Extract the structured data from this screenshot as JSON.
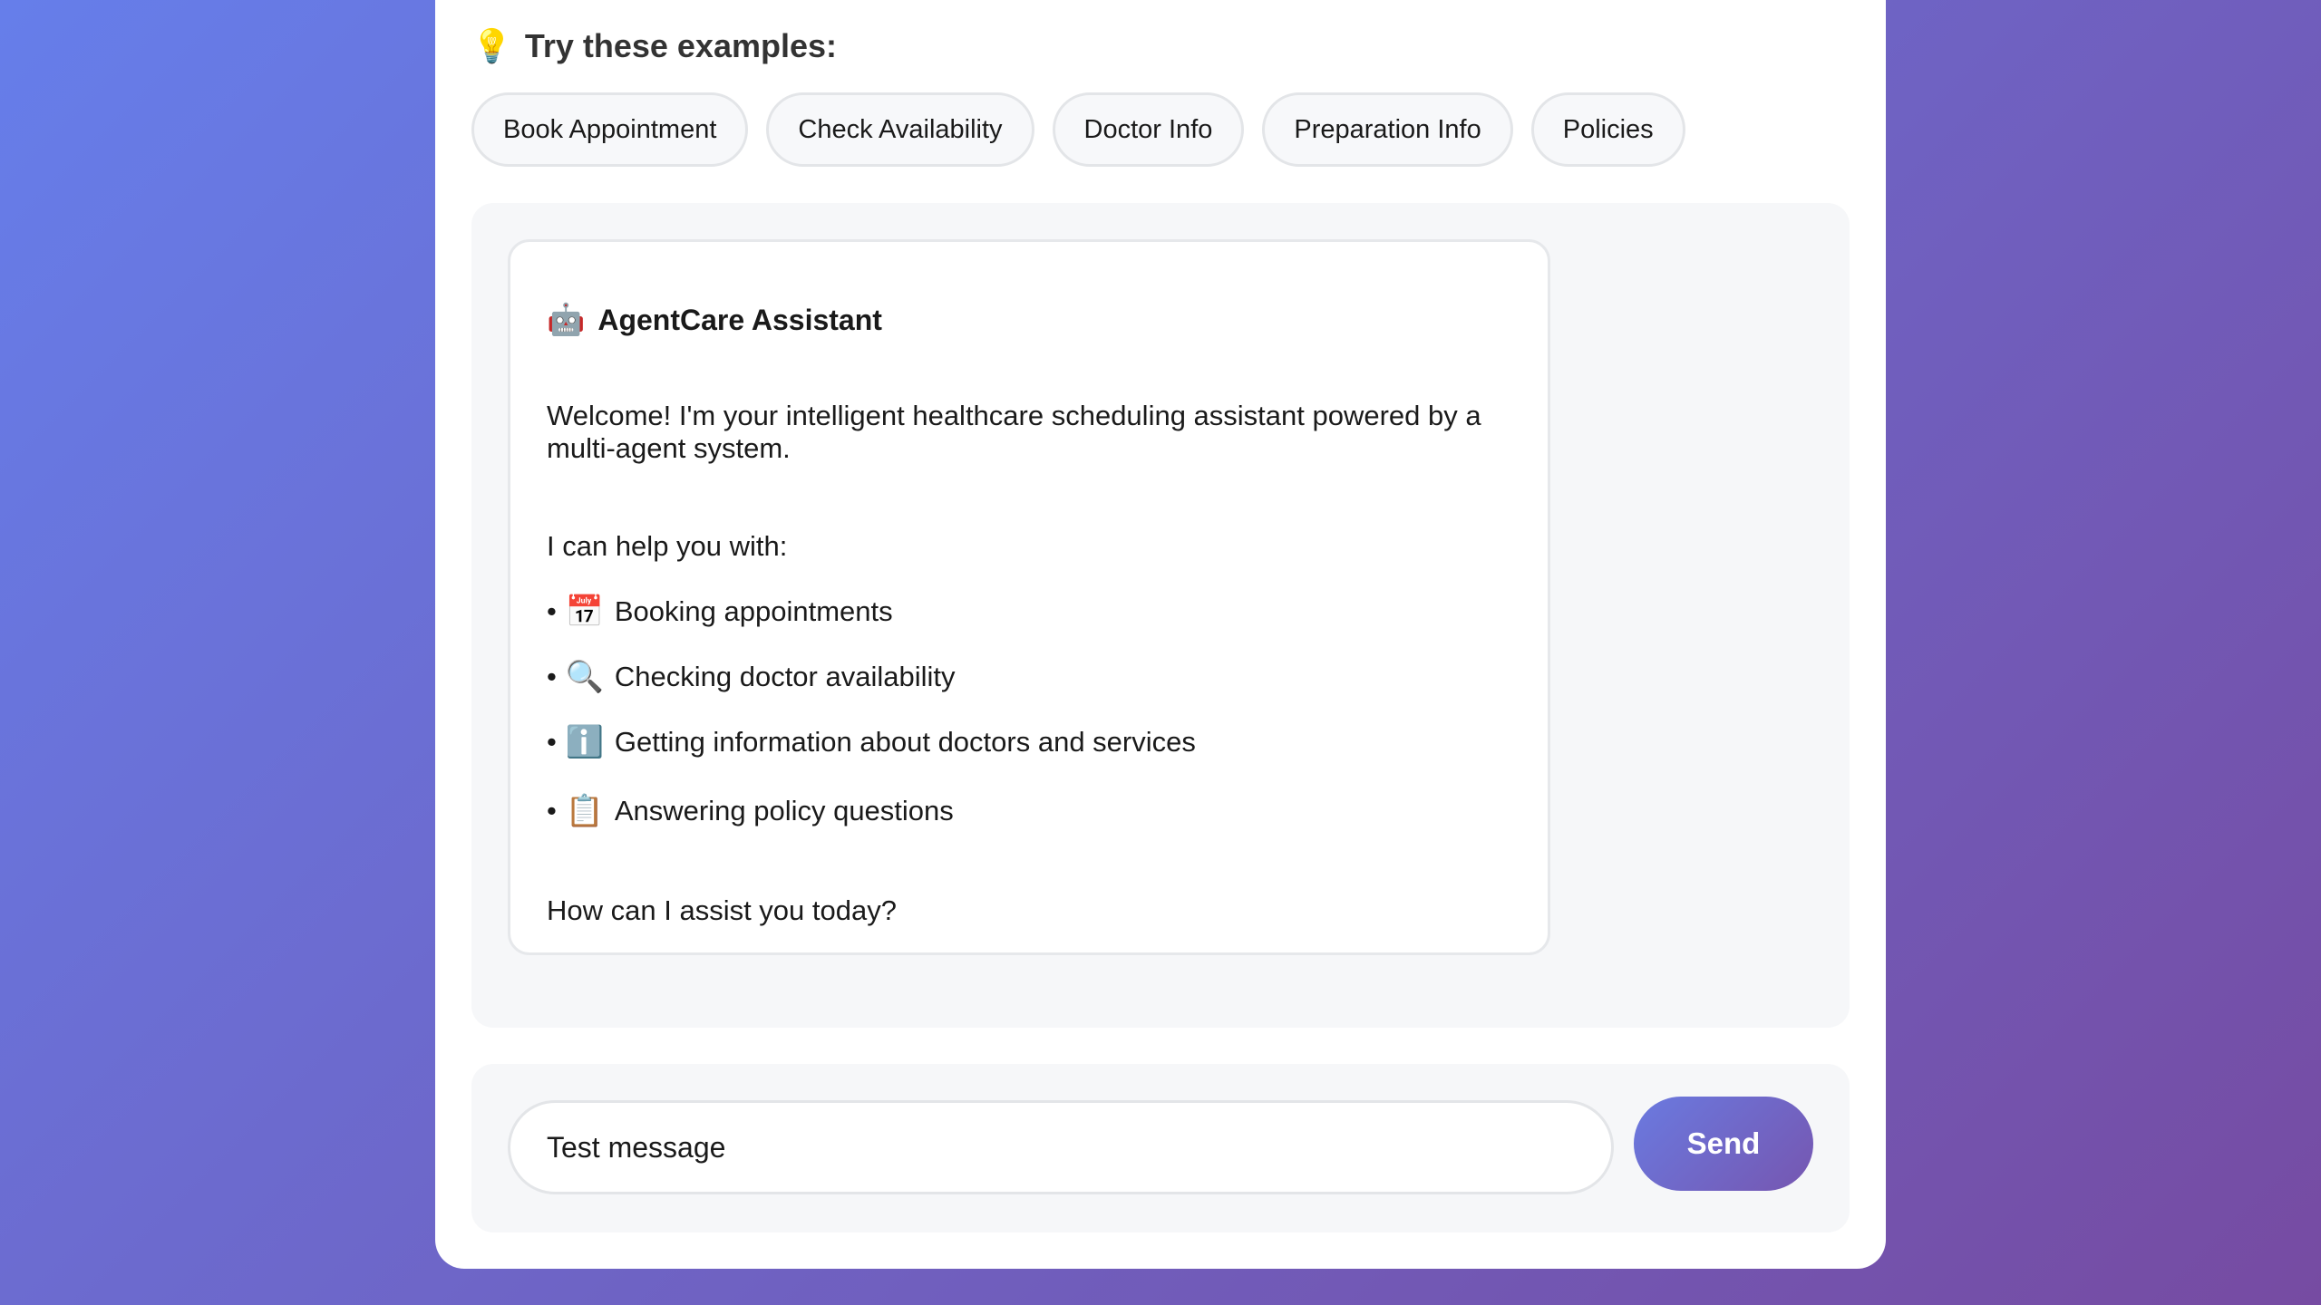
{
  "examples": {
    "icon": "lightbulb-icon",
    "heading": "Try these examples:",
    "chips": [
      "Book Appointment",
      "Check Availability",
      "Doctor Info",
      "Preparation Info",
      "Policies"
    ]
  },
  "chat": {
    "assistant_icon": "robot-icon",
    "assistant_name": "AgentCare Assistant",
    "welcome": "Welcome! I'm your intelligent healthcare scheduling assistant powered by a multi-agent system.",
    "help_intro": "I can help you with:",
    "capabilities": [
      {
        "icon": "calendar-icon",
        "text": "Booking appointments"
      },
      {
        "icon": "magnifier-icon",
        "text": "Checking doctor availability"
      },
      {
        "icon": "info-icon",
        "text": "Getting information about doctors and services"
      },
      {
        "icon": "clipboard-icon",
        "text": "Answering policy questions"
      }
    ],
    "closing": "How can I assist you today?"
  },
  "composer": {
    "input_value": "Test message",
    "send_label": "Send"
  },
  "colors": {
    "background_start": "#667eea",
    "background_end": "#764ba2",
    "send_button": "#6a7ae0"
  }
}
